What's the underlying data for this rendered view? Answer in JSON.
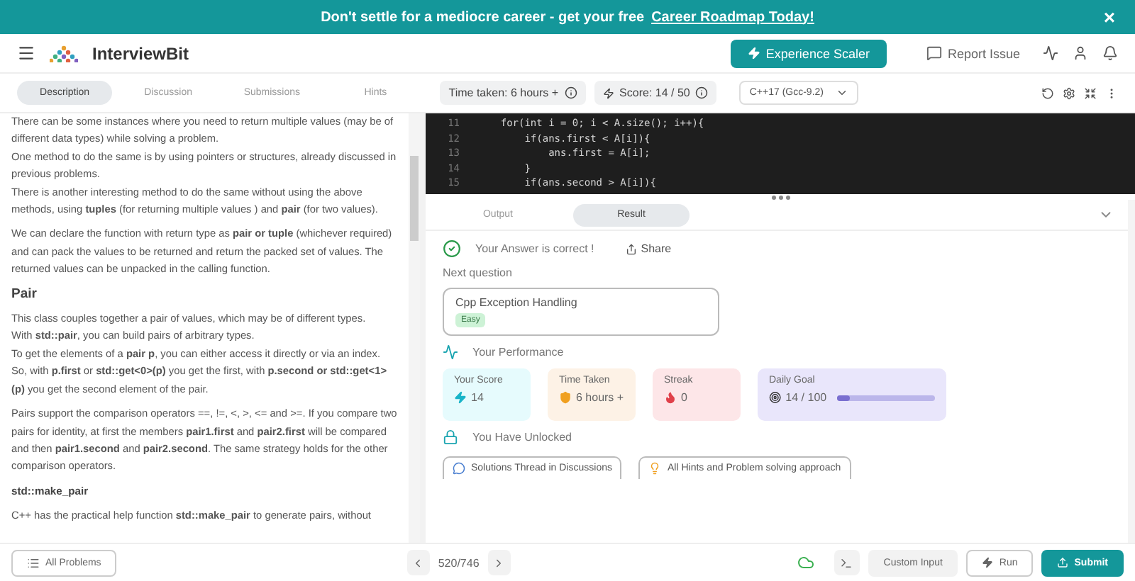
{
  "banner": {
    "text": "Don't settle for a mediocre career - get your free",
    "link": "Career Roadmap Today!",
    "close": "×"
  },
  "header": {
    "logo": "InterviewBit",
    "cta": "Experience Scaler",
    "report": "Report Issue"
  },
  "tabs": [
    {
      "label": "Description",
      "selected": true
    },
    {
      "label": "Discussion",
      "selected": false
    },
    {
      "label": "Submissions",
      "selected": false
    },
    {
      "label": "Hints",
      "selected": false
    }
  ],
  "toolbar": {
    "time_taken": "Time taken: 6 hours +",
    "score": "Score: 14 / 50",
    "language": "C++17 (Gcc-9.2)"
  },
  "description": [
    {
      "kind": "p",
      "text": "There can be some instances where you need to return multiple values (may be of different data types) while solving a problem."
    },
    {
      "kind": "line",
      "text": "One method to do the same is by using pointers or structures, already discussed in previous problems."
    },
    {
      "kind": "line",
      "text": "There is another interesting method to do the same without using the above methods, using **tuples** (for returning multiple values ) and **pair** (for two values)."
    },
    {
      "kind": "p",
      "text": "We can declare the function with return type as **pair or tuple** (whichever required) and can pack the values to be returned and return the packed set of values. The returned values can be unpacked in the calling function."
    },
    {
      "kind": "heading",
      "text": "Pair"
    },
    {
      "kind": "p",
      "text": "This class couples together a pair of values, which may be of different types."
    },
    {
      "kind": "line",
      "text": "With **std::pair**, you can build pairs of arbitrary types."
    },
    {
      "kind": "line",
      "text": "To get the elements of a **pair p**, you can either access it directly or via an index."
    },
    {
      "kind": "line",
      "text": "So, with **p.first** or **std::get<0>(p)** you get the first, with **p.second or std::get<1>(p)** you get the second element of the pair."
    },
    {
      "kind": "p",
      "text": "Pairs support the comparison operators ==, !=, <, >, <= and >=. If you compare two pairs for identity, at first the members **pair1.first** and **pair2.first** will be compared and then **pair1.second** and **pair2.second**. The same strategy holds for the other comparison operators."
    },
    {
      "kind": "subheading",
      "text": "std::make_pair"
    },
    {
      "kind": "p",
      "text": "C++ has the practical help function **std::make_pair** to generate pairs, without"
    }
  ],
  "editor": [
    {
      "number": "11",
      "code": "    for(int i = 0; i < A.size(); i++){"
    },
    {
      "number": "12",
      "code": "        if(ans.first < A[i]){"
    },
    {
      "number": "13",
      "code": "            ans.first = A[i];"
    },
    {
      "number": "14",
      "code": "        }"
    },
    {
      "number": "15",
      "code": "        if(ans.second > A[i]){"
    }
  ],
  "result": {
    "tabs": [
      {
        "label": "Output",
        "selected": false
      },
      {
        "label": "Result",
        "selected": true
      }
    ],
    "status": "Your Answer is correct !",
    "share": "Share",
    "next_label": "Next question",
    "next": {
      "title": "Cpp Exception Handling",
      "difficulty": "Easy"
    },
    "performance_title": "Your Performance",
    "stats": [
      {
        "kind": "score",
        "label": "Your Score",
        "value": "14",
        "color": "#e6fbfd"
      },
      {
        "kind": "time",
        "label": "Time Taken",
        "value": "6 hours +",
        "color": "#fdf2e6"
      },
      {
        "kind": "streak",
        "label": "Streak",
        "value": "0",
        "color": "#fde6e8"
      },
      {
        "kind": "goal",
        "label": "Daily Goal",
        "value": "14 / 100",
        "color": "#e9e6fb",
        "level": 0.14
      }
    ],
    "unlocked_title": "You Have Unlocked",
    "unlocked": [
      {
        "kind": "discussion",
        "label": "Solutions Thread in Discussions"
      },
      {
        "kind": "hints",
        "label": "All Hints and Problem solving approach"
      }
    ]
  },
  "bottom": {
    "all_problems": "All Problems",
    "counter": "520/746",
    "custom_input": "Custom Input",
    "run": "Run",
    "submit": "Submit"
  }
}
